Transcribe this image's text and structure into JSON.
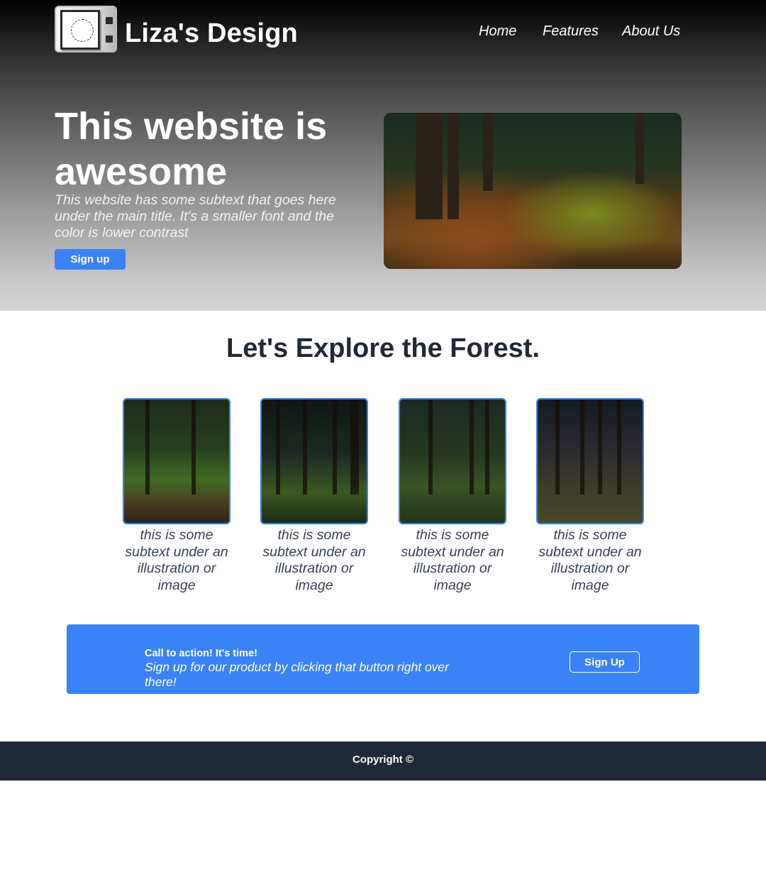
{
  "header": {
    "logo_icon": "framed-seal-logo",
    "brand": "Liza's Design",
    "nav": [
      "Home",
      "Features",
      "About Us"
    ]
  },
  "hero": {
    "title": "This website is awesome",
    "subtitle": "This website has some subtext that goes here under the main title. It's a smaller font and the color is lower contrast",
    "cta_label": "Sign up",
    "image": "forest-floor-photo"
  },
  "explore": {
    "title": "Let's Explore the Forest.",
    "cards": [
      {
        "image": "forest-path-photo",
        "caption": "this is some subtext under an illustration or image"
      },
      {
        "image": "dark-forest-trunks-photo",
        "caption": "this is some subtext under an illustration or image"
      },
      {
        "image": "mossy-forest-photo",
        "caption": "this is some subtext under an illustration or image"
      },
      {
        "image": "forest-dusk-photo",
        "caption": "this is some subtext under an illustration or image"
      }
    ]
  },
  "cta": {
    "heading": "Call to action! It's time!",
    "text": "Sign up for our product by clicking that button right over there!",
    "button": "Sign Up"
  },
  "footer": {
    "copyright": "Copyright ©"
  },
  "colors": {
    "accent": "#3b82f6",
    "footer_bg": "#1f2937",
    "heading": "#1f2937"
  }
}
